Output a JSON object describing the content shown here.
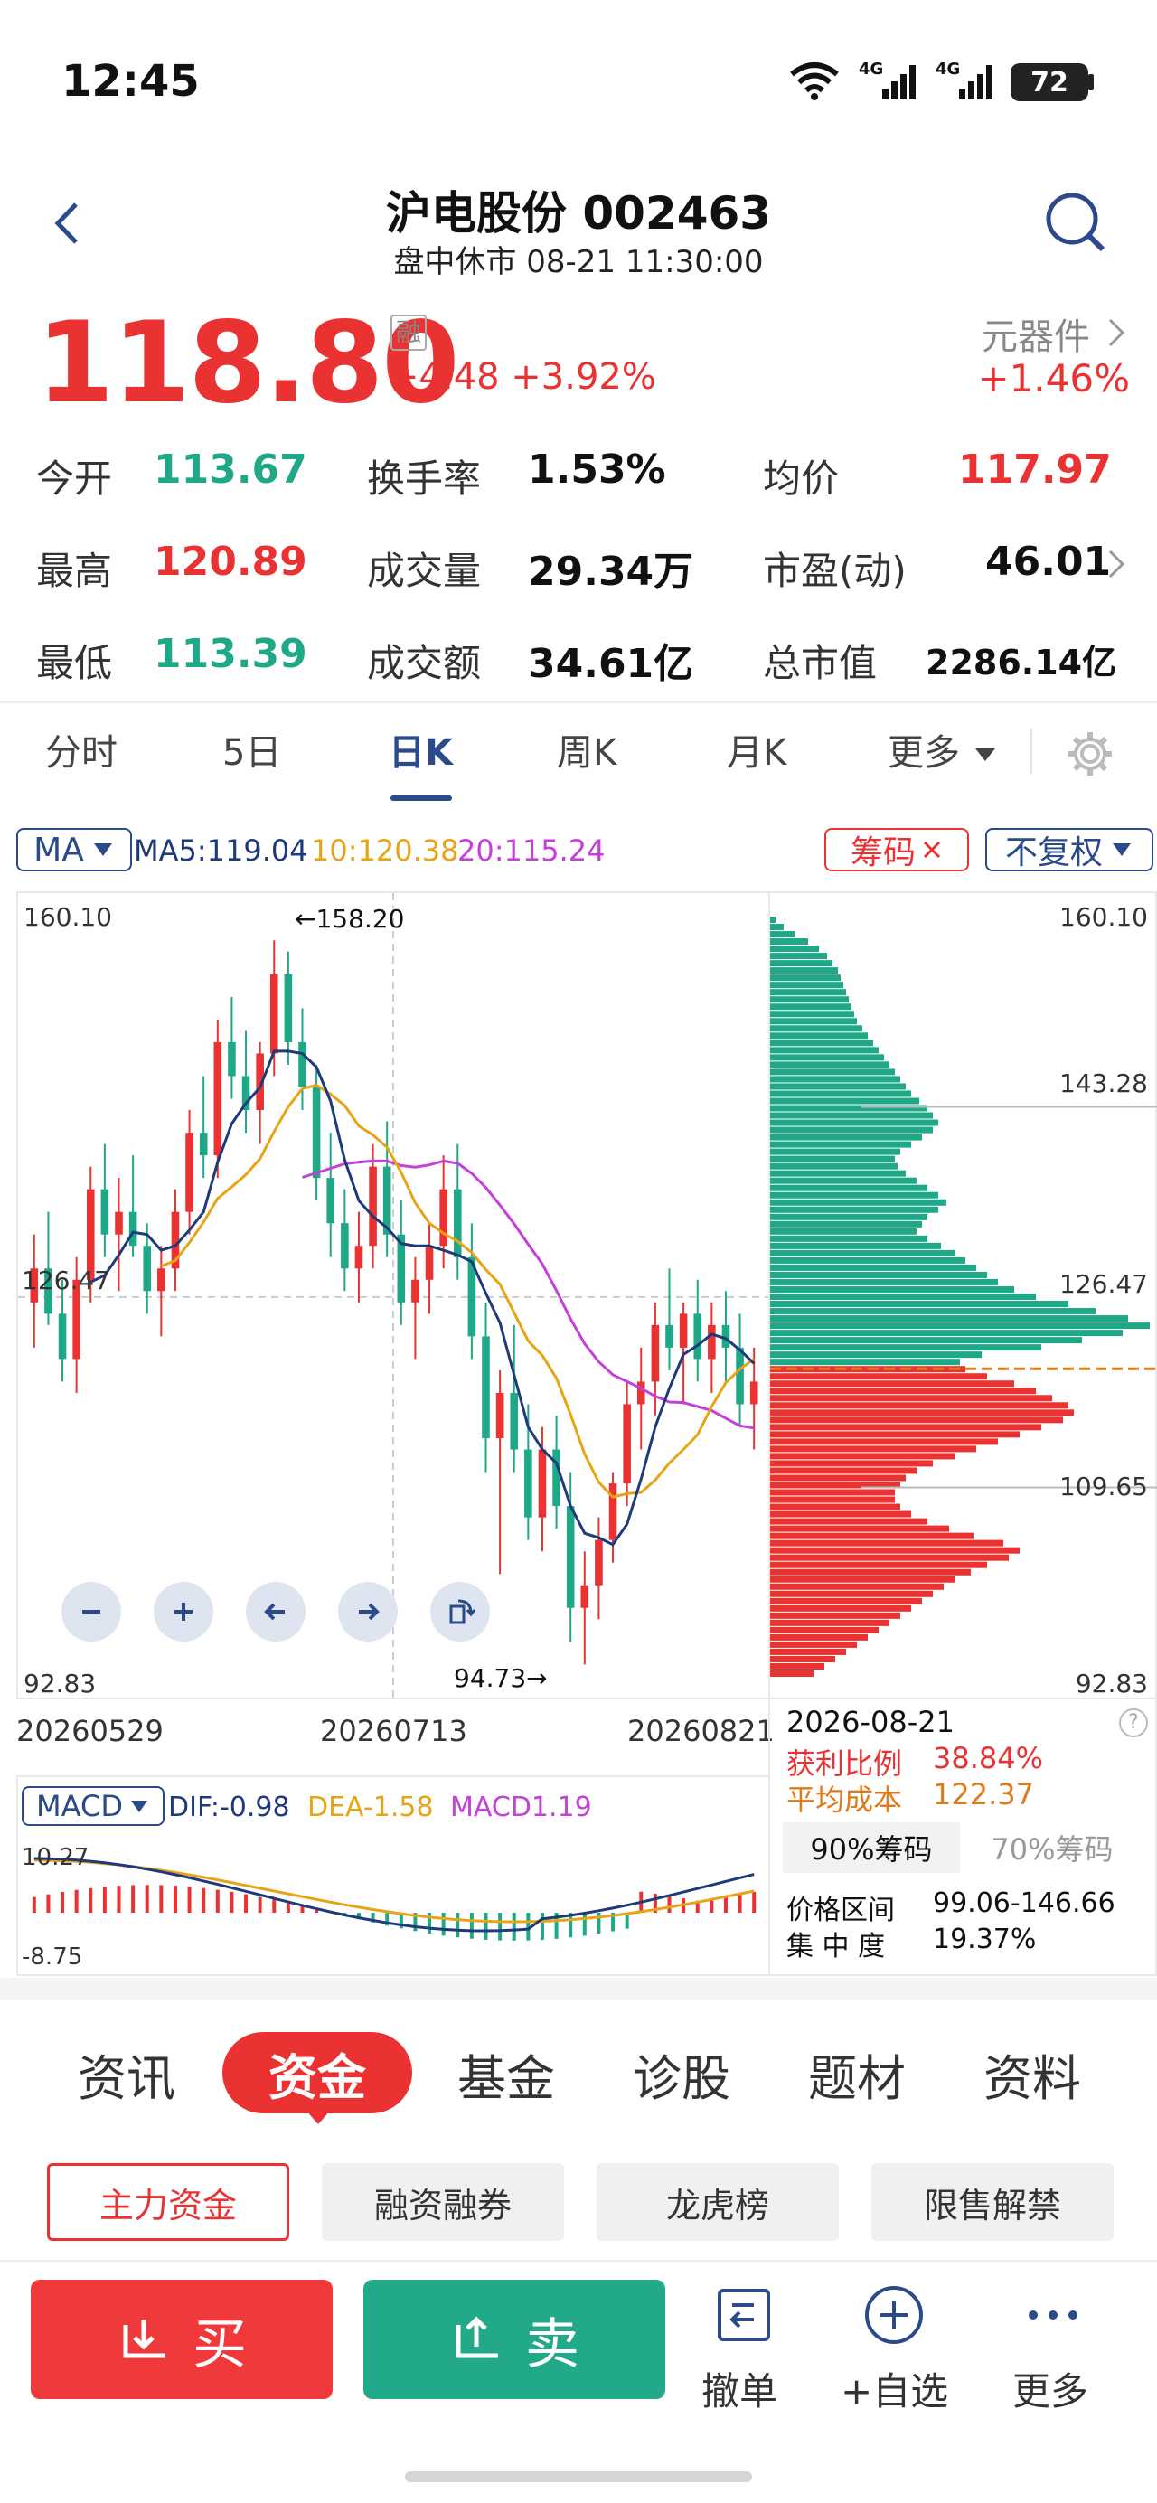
{
  "status_bar": {
    "time": "12:45",
    "network1": "4G",
    "network2": "4G",
    "battery": "72"
  },
  "header": {
    "stock_name_code": "沪电股份 002463",
    "status_line": "盘中休市 08-21 11:30:00"
  },
  "quote": {
    "price": "118.80",
    "badge": "融",
    "change": "+4.48 +3.92%",
    "sector": "元器件",
    "sector_change": "+1.46%"
  },
  "stats": {
    "open_label": "今开",
    "open": "113.67",
    "turnover_label": "换手率",
    "turnover": "1.53%",
    "avg_label": "均价",
    "avg": "117.97",
    "high_label": "最高",
    "high": "120.89",
    "volume_label": "成交量",
    "volume": "29.34万",
    "pe_label": "市盈(动)",
    "pe": "46.01",
    "low_label": "最低",
    "low": "113.39",
    "amount_label": "成交额",
    "amount": "34.61亿",
    "mcap_label": "总市值",
    "mcap": "2286.14亿"
  },
  "chart_tabs": {
    "t1": "分时",
    "t2": "5日",
    "t3": "日K",
    "t4": "周K",
    "t5": "月K",
    "t6": "更多"
  },
  "ma_bar": {
    "ma_btn": "MA",
    "ma5": "MA5:119.04",
    "ma10": "10:120.38",
    "ma20": "20:115.24",
    "chip_btn": "筹码",
    "fq_btn": "不复权"
  },
  "colors": {
    "up": "#ea3232",
    "down": "#1fa888",
    "ma5": "#1f3a7a",
    "ma10": "#e6a416",
    "ma20": "#c540d8",
    "chip_cost": "#e07a1a"
  },
  "kline": {
    "y_top": "160.10",
    "y_mid": "126.47",
    "y_bottom": "92.83",
    "high_marker": "←158.20",
    "low_marker": "94.73→",
    "date1": "20260529",
    "date2": "20260713",
    "date3": "20260821"
  },
  "chips": {
    "price_labels": [
      "160.10",
      "143.28",
      "126.47",
      "109.65",
      "92.83"
    ],
    "date": "2026-08-21",
    "profit_label": "获利比例",
    "profit": "38.84%",
    "cost_label": "平均成本",
    "cost": "122.37",
    "tab90": "90%筹码",
    "tab70": "70%筹码",
    "range_label": "价格区间",
    "range": "99.06-146.66",
    "conc_label": "集 中 度",
    "conc": "19.37%",
    "bins": [
      2,
      5,
      9,
      14,
      18,
      21,
      23,
      25,
      26,
      27,
      28,
      29,
      30,
      31,
      32,
      34,
      36,
      38,
      40,
      42,
      44,
      46,
      48,
      50,
      52,
      55,
      58,
      60,
      62,
      60,
      56,
      52,
      48,
      46,
      47,
      50,
      54,
      58,
      62,
      65,
      62,
      58,
      56,
      54,
      58,
      63,
      68,
      72,
      76,
      80,
      84,
      90,
      98,
      110,
      120,
      132,
      140,
      130,
      115,
      100,
      78,
      70,
      72,
      80,
      90,
      98,
      104,
      110,
      112,
      108,
      100,
      92,
      84,
      76,
      68,
      60,
      54,
      50,
      48,
      46,
      46,
      48,
      52,
      58,
      66,
      75,
      86,
      92,
      88,
      80,
      74,
      68,
      64,
      60,
      56,
      52,
      48,
      44,
      40,
      36,
      32,
      28,
      24,
      20,
      16
    ]
  },
  "macd": {
    "btn": "MACD",
    "dif": "DIF:-0.98",
    "dea": "DEA-1.58",
    "macd": "MACD1.19",
    "y_top": "10.27",
    "y_bottom": "-8.75"
  },
  "bottom_tabs": {
    "t1": "资讯",
    "t2": "资金",
    "t3": "基金",
    "t4": "诊股",
    "t5": "题材",
    "t6": "资料"
  },
  "sub_tabs": {
    "s1": "主力资金",
    "s2": "融资融券",
    "s3": "龙虎榜",
    "s4": "限售解禁"
  },
  "actions": {
    "buy": "买",
    "sell": "卖",
    "cancel": "撤单",
    "watch": "+自选",
    "more": "更多"
  },
  "candles": [
    [
      126,
      132,
      122,
      129
    ],
    [
      129,
      134,
      124,
      125
    ],
    [
      125,
      128,
      119,
      121
    ],
    [
      121,
      130,
      118,
      128
    ],
    [
      128,
      138,
      126,
      136
    ],
    [
      136,
      140,
      130,
      132
    ],
    [
      132,
      137,
      127,
      134
    ],
    [
      134,
      139,
      130,
      131
    ],
    [
      131,
      133,
      125,
      127
    ],
    [
      127,
      131,
      123,
      129
    ],
    [
      129,
      136,
      127,
      134
    ],
    [
      134,
      143,
      132,
      141
    ],
    [
      141,
      146,
      137,
      139
    ],
    [
      139,
      151,
      137,
      149
    ],
    [
      149,
      153,
      144,
      146
    ],
    [
      146,
      150,
      141,
      143
    ],
    [
      143,
      149,
      140,
      148
    ],
    [
      148,
      158,
      146,
      155
    ],
    [
      155,
      157,
      147,
      149
    ],
    [
      149,
      152,
      143,
      145
    ],
    [
      145,
      147,
      135,
      137
    ],
    [
      137,
      141,
      130,
      133
    ],
    [
      133,
      136,
      127,
      129
    ],
    [
      129,
      134,
      126,
      131
    ],
    [
      131,
      140,
      129,
      138
    ],
    [
      138,
      142,
      130,
      132
    ],
    [
      132,
      135,
      124,
      126
    ],
    [
      126,
      130,
      121,
      128
    ],
    [
      128,
      133,
      125,
      131
    ],
    [
      131,
      139,
      129,
      136
    ],
    [
      136,
      140,
      128,
      130
    ],
    [
      130,
      133,
      121,
      123
    ],
    [
      123,
      126,
      111,
      114
    ],
    [
      114,
      120,
      102,
      118
    ],
    [
      118,
      124,
      111,
      113
    ],
    [
      113,
      117,
      105,
      107
    ],
    [
      107,
      115,
      104,
      113
    ],
    [
      113,
      116,
      106,
      108
    ],
    [
      108,
      111,
      96,
      99
    ],
    [
      99,
      104,
      94,
      101
    ],
    [
      101,
      107,
      98,
      105
    ],
    [
      105,
      111,
      103,
      110
    ],
    [
      110,
      119,
      108,
      117
    ],
    [
      117,
      122,
      113,
      119
    ],
    [
      119,
      126,
      116,
      124
    ],
    [
      124,
      129,
      120,
      122
    ],
    [
      122,
      126,
      117,
      125
    ],
    [
      125,
      128,
      119,
      121
    ],
    [
      121,
      126,
      118,
      124
    ],
    [
      124,
      127,
      119,
      122
    ],
    [
      122,
      125,
      115,
      117
    ],
    [
      117,
      122,
      113,
      119
    ]
  ]
}
